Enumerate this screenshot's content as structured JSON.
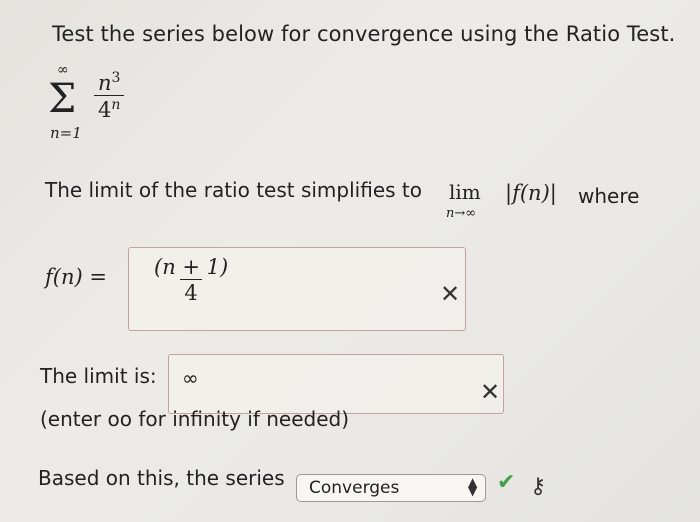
{
  "question": {
    "title": "Test the series below for convergence using the Ratio Test.",
    "series": {
      "sigma": "Σ",
      "upper": "∞",
      "lower": "n=1",
      "numerator": "n",
      "numerator_exp": "3",
      "denominator": "4",
      "denominator_exp": "n"
    }
  },
  "ratio": {
    "text": "The limit of the ratio test simplifies to",
    "lim_word": "lim",
    "lim_sub": "n→∞",
    "abs_expr": "|f(n)|",
    "where": "where"
  },
  "f_answer": {
    "label": "f(n) =",
    "numerator": "(n + 1)",
    "denominator": "4",
    "status_icon": "x-mark"
  },
  "limit_answer": {
    "label": "The limit is:",
    "value": "∞",
    "hint": "(enter oo for infinity if needed)",
    "status_icon": "x-mark"
  },
  "conclusion": {
    "label": "Based on this, the series",
    "selected": "Converges",
    "status_icon": "check-mark",
    "key_icon": "key-icon"
  },
  "colors": {
    "incorrect_border": "#c8a0a0",
    "check_green": "#3fa247"
  }
}
